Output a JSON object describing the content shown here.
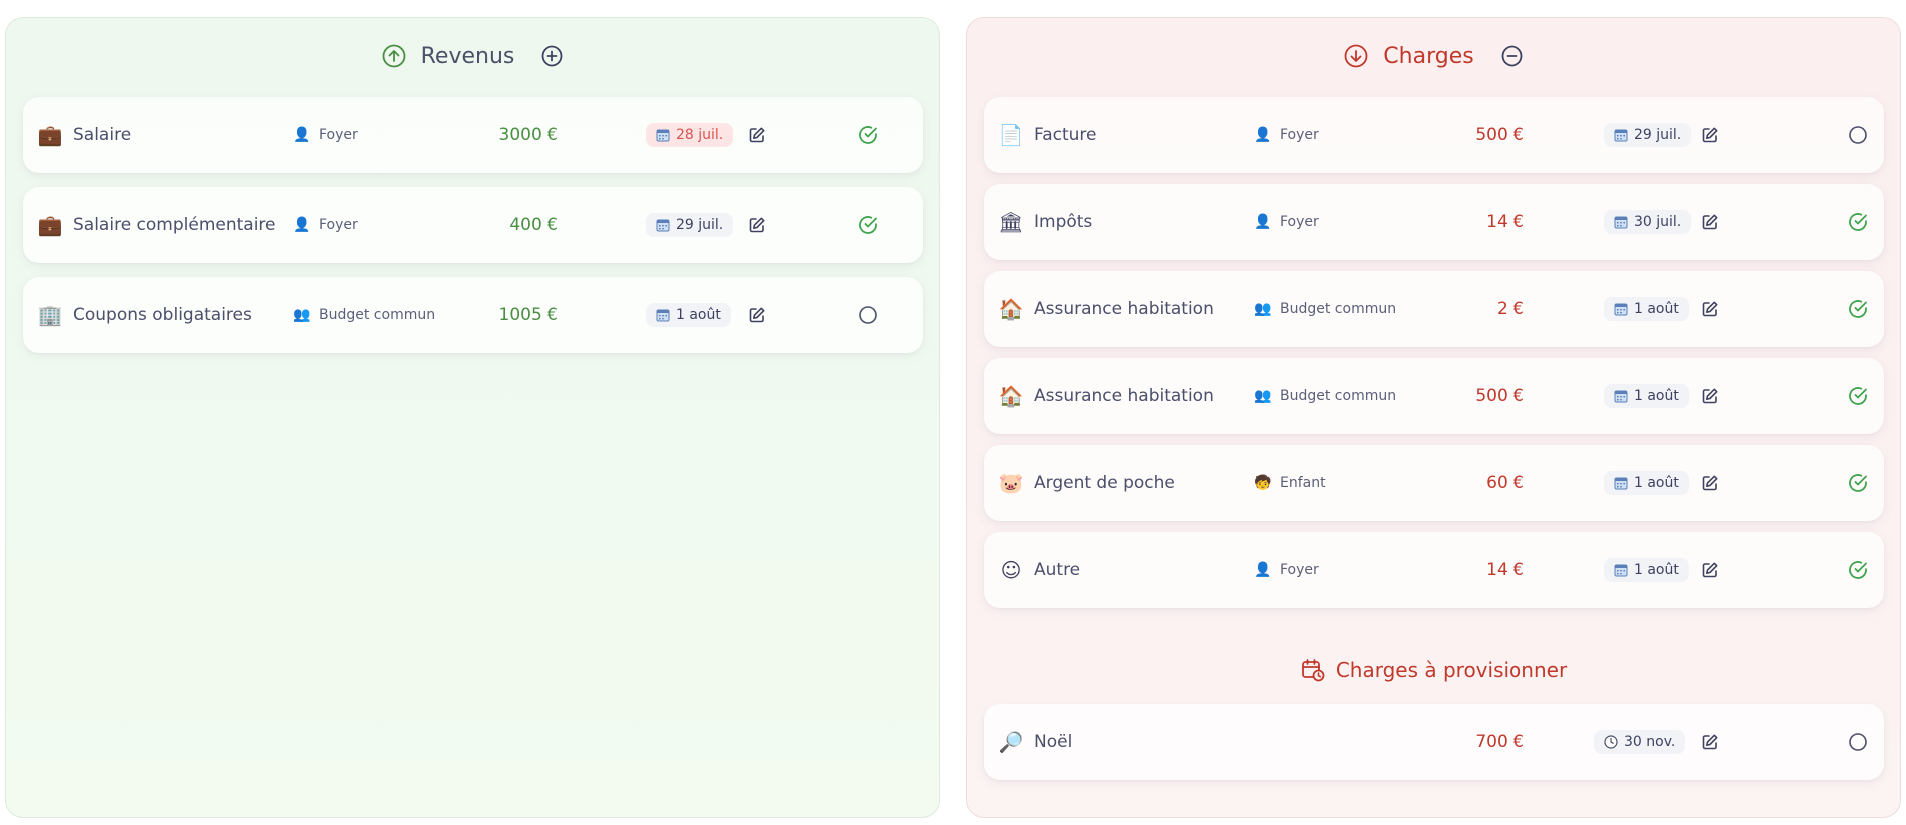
{
  "income": {
    "title": "Revenus",
    "rows": [
      {
        "icon": "💼",
        "name": "Salaire",
        "owner_icon": "👤",
        "owner": "Foyer",
        "amount": "3000 €",
        "date": "28 juil.",
        "date_overdue": true,
        "status": "done"
      },
      {
        "icon": "💼",
        "name": "Salaire complémentaire",
        "owner_icon": "👤",
        "owner": "Foyer",
        "amount": "400 €",
        "date": "29 juil.",
        "date_overdue": false,
        "status": "done"
      },
      {
        "icon": "🏢",
        "name": "Coupons obligataires",
        "owner_icon": "👥",
        "owner": "Budget commun",
        "amount": "1005 €",
        "date": "1 août",
        "date_overdue": false,
        "status": "pending"
      }
    ]
  },
  "expenses": {
    "title": "Charges",
    "rows": [
      {
        "icon": "📄",
        "name": "Facture",
        "owner_icon": "👤",
        "owner": "Foyer",
        "amount": "500 €",
        "date": "29 juil.",
        "status": "pending"
      },
      {
        "icon": "🏛",
        "name": "Impôts",
        "owner_icon": "👤",
        "owner": "Foyer",
        "amount": "14 €",
        "date": "30 juil.",
        "status": "done"
      },
      {
        "icon": "🏠",
        "name": "Assurance habitation",
        "owner_icon": "👥",
        "owner": "Budget commun",
        "amount": "2 €",
        "date": "1 août",
        "status": "done"
      },
      {
        "icon": "🏠",
        "name": "Assurance habitation",
        "owner_icon": "👥",
        "owner": "Budget commun",
        "amount": "500 €",
        "date": "1 août",
        "status": "done"
      },
      {
        "icon": "🐷",
        "name": "Argent de poche",
        "owner_icon": "🧒",
        "owner": "Enfant",
        "amount": "60 €",
        "date": "1 août",
        "status": "done"
      },
      {
        "icon": "☺",
        "name": "Autre",
        "owner_icon": "👤",
        "owner": "Foyer",
        "amount": "14 €",
        "date": "1 août",
        "status": "done"
      }
    ]
  },
  "provisions": {
    "title": "Charges à provisionner",
    "rows": [
      {
        "icon": "🔎",
        "name": "Noël",
        "amount": "700 €",
        "date": "30 nov.",
        "status": "pending"
      }
    ]
  },
  "colors": {
    "income_accent": "#4a8e43",
    "expense_accent": "#c0392b",
    "check_done": "#3fa34d",
    "check_pending": "#4a4f6a"
  }
}
